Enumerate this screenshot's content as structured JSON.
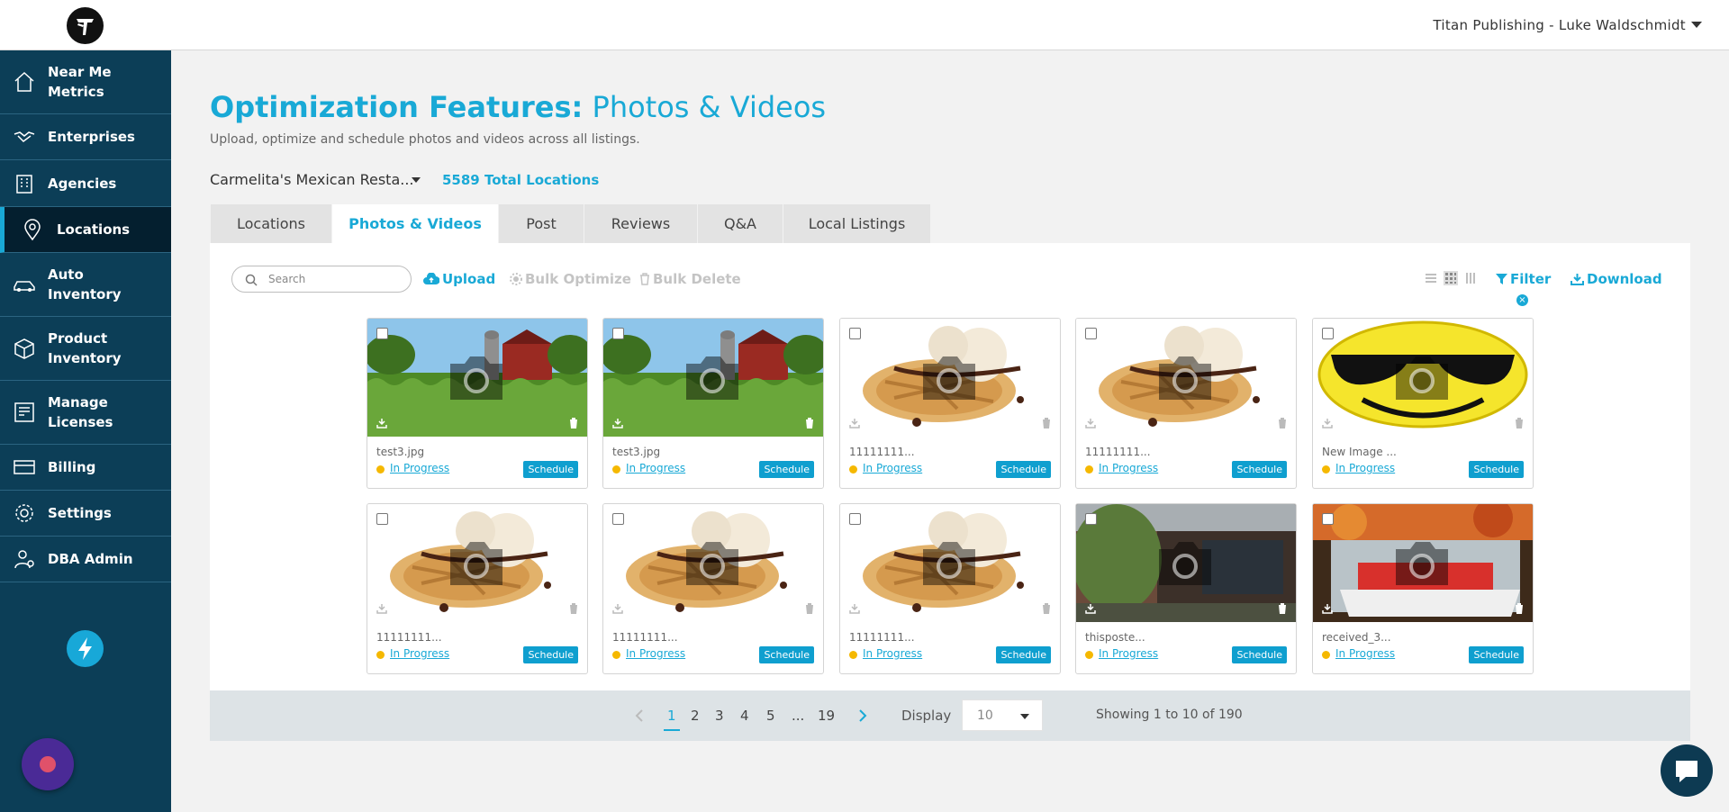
{
  "topbar": {
    "account_label": "Titan Publishing - Luke Waldschmidt"
  },
  "sidebar": {
    "items": [
      {
        "label": "Near Me Metrics",
        "icon": "home-icon"
      },
      {
        "label": "Enterprises",
        "icon": "handshake-icon"
      },
      {
        "label": "Agencies",
        "icon": "building-icon"
      },
      {
        "label": "Locations",
        "icon": "map-pin-icon",
        "active": true
      },
      {
        "label": "Auto Inventory",
        "icon": "car-icon"
      },
      {
        "label": "Product Inventory",
        "icon": "box-icon"
      },
      {
        "label": "Manage Licenses",
        "icon": "license-icon"
      },
      {
        "label": "Billing",
        "icon": "billing-icon"
      },
      {
        "label": "Settings",
        "icon": "gear-icon"
      },
      {
        "label": "DBA Admin",
        "icon": "admin-user-icon"
      }
    ]
  },
  "header": {
    "title_bold": "Optimization Features:",
    "title_light": "Photos & Videos",
    "subtitle": "Upload, optimize and schedule photos and videos across all listings.",
    "location_select": "Carmelita's Mexican Resta...",
    "total_locations": "5589 Total Locations"
  },
  "tabs": [
    {
      "label": "Locations"
    },
    {
      "label": "Photos & Videos",
      "active": true
    },
    {
      "label": "Post"
    },
    {
      "label": "Reviews"
    },
    {
      "label": "Q&A"
    },
    {
      "label": "Local Listings"
    }
  ],
  "toolbar": {
    "search_placeholder": "Search",
    "upload_label": "Upload",
    "bulk_optimize_label": "Bulk Optimize",
    "bulk_delete_label": "Bulk Delete",
    "filter_label": "Filter",
    "download_label": "Download"
  },
  "media": [
    {
      "name": "test3.jpg",
      "status": "In Progress",
      "action": "Schedule",
      "image": "farm"
    },
    {
      "name": "test3.jpg",
      "status": "In Progress",
      "action": "Schedule",
      "image": "farm"
    },
    {
      "name": "11111111...",
      "status": "In Progress",
      "action": "Schedule",
      "image": "waffle"
    },
    {
      "name": "11111111...",
      "status": "In Progress",
      "action": "Schedule",
      "image": "waffle"
    },
    {
      "name": "New Image ...",
      "status": "In Progress",
      "action": "Schedule",
      "image": "smiley"
    },
    {
      "name": "11111111...",
      "status": "In Progress",
      "action": "Schedule",
      "image": "waffle"
    },
    {
      "name": "11111111...",
      "status": "In Progress",
      "action": "Schedule",
      "image": "waffle"
    },
    {
      "name": "11111111...",
      "status": "In Progress",
      "action": "Schedule",
      "image": "waffle"
    },
    {
      "name": "thisposte...",
      "status": "In Progress",
      "action": "Schedule",
      "image": "building"
    },
    {
      "name": "received_3...",
      "status": "In Progress",
      "action": "Schedule",
      "image": "food"
    }
  ],
  "pagination": {
    "pages": [
      "1",
      "2",
      "3",
      "4",
      "5",
      "...",
      "19"
    ],
    "current": "1",
    "display_label": "Display",
    "display_value": "10",
    "showing_text": "Showing 1 to 10 of 190"
  },
  "colors": {
    "accent": "#19a9d6",
    "sidebar_bg": "#0c3e57",
    "sidebar_active": "#041f2f",
    "status_dot": "#f5b800"
  }
}
